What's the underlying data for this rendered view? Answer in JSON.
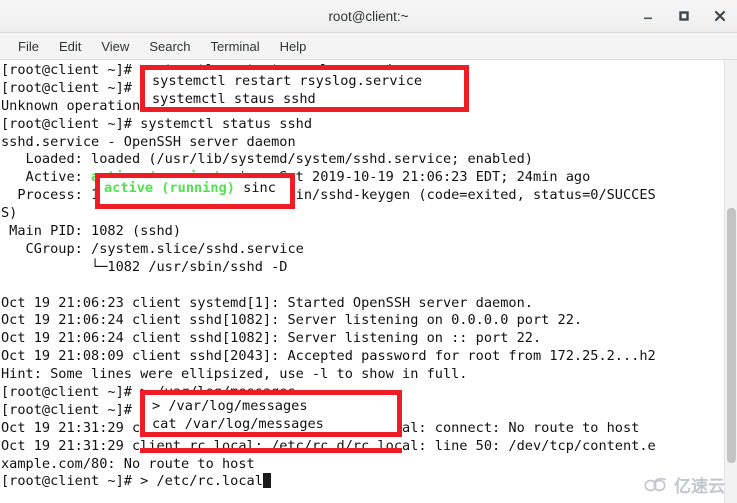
{
  "window": {
    "title": "root@client:~",
    "buttons": {
      "minimize": "minimize",
      "maximize": "maximize",
      "close": "close"
    }
  },
  "menubar": {
    "items": [
      {
        "label": "File"
      },
      {
        "label": "Edit"
      },
      {
        "label": "View"
      },
      {
        "label": "Search"
      },
      {
        "label": "Terminal"
      },
      {
        "label": "Help"
      }
    ]
  },
  "terminal": {
    "prompt": "[root@client ~]#",
    "lines": [
      {
        "text": "[root@client ~]# systemctl restart rsyslog.service"
      },
      {
        "text": "[root@client ~]# systemctl staus sshd"
      },
      {
        "text": "Unknown operation 'staus'."
      },
      {
        "text": "[root@client ~]# systemctl status sshd"
      },
      {
        "text": "sshd.service - OpenSSH server daemon"
      },
      {
        "text": "   Loaded: loaded (/usr/lib/systemd/system/sshd.service; enabled)"
      },
      {
        "text": "   Active: active (running) since Sat 2019-10-19 21:06:23 EDT; 24min ago"
      },
      {
        "text": "  Process: 1071 ExecStartPre=/usr/sbin/sshd-keygen (code=exited, status=0/SUCCES"
      },
      {
        "text": "S)"
      },
      {
        "text": " Main PID: 1082 (sshd)"
      },
      {
        "text": "   CGroup: /system.slice/sshd.service"
      },
      {
        "text": "           └─1082 /usr/sbin/sshd -D"
      },
      {
        "text": ""
      },
      {
        "text": "Oct 19 21:06:23 client systemd[1]: Started OpenSSH server daemon."
      },
      {
        "text": "Oct 19 21:06:24 client sshd[1082]: Server listening on 0.0.0.0 port 22."
      },
      {
        "text": "Oct 19 21:06:24 client sshd[1082]: Server listening on :: port 22."
      },
      {
        "text": "Oct 19 21:08:09 client sshd[2043]: Accepted password for root from 172.25.2...h2"
      },
      {
        "text": "Hint: Some lines were ellipsized, use -l to show in full."
      },
      {
        "text": "[root@client ~]# > /var/log/messages"
      },
      {
        "text": "[root@client ~]# cat /var/log/messages"
      },
      {
        "text": "Oct 19 21:31:29 client rc.local: /etc/rc.d/rc.local: connect: No route to host"
      },
      {
        "text": "Oct 19 21:31:29 client rc.local: /etc/rc.d/rc.local: line 50: /dev/tcp/content.e"
      },
      {
        "text": "xample.com/80: No route to host"
      },
      {
        "text": "[root@client ~]# > /etc/rc.local"
      }
    ],
    "active_status_text": "active (running)",
    "active_status_color": "#4ee44e",
    "current_command": "[root@client ~]# > /etc/rc.local"
  },
  "annotations": {
    "highlight_color": "#ee1c25",
    "box1": {
      "line1": "systemctl restart rsyslog.service",
      "line2": "systemctl staus sshd"
    },
    "box2": {
      "prefix": "active (running)",
      "suffix": " sinc"
    },
    "box3": {
      "line1": "> /var/log/messages",
      "line2": "cat /var/log/messages"
    }
  },
  "watermark": {
    "text": "亿速云"
  }
}
